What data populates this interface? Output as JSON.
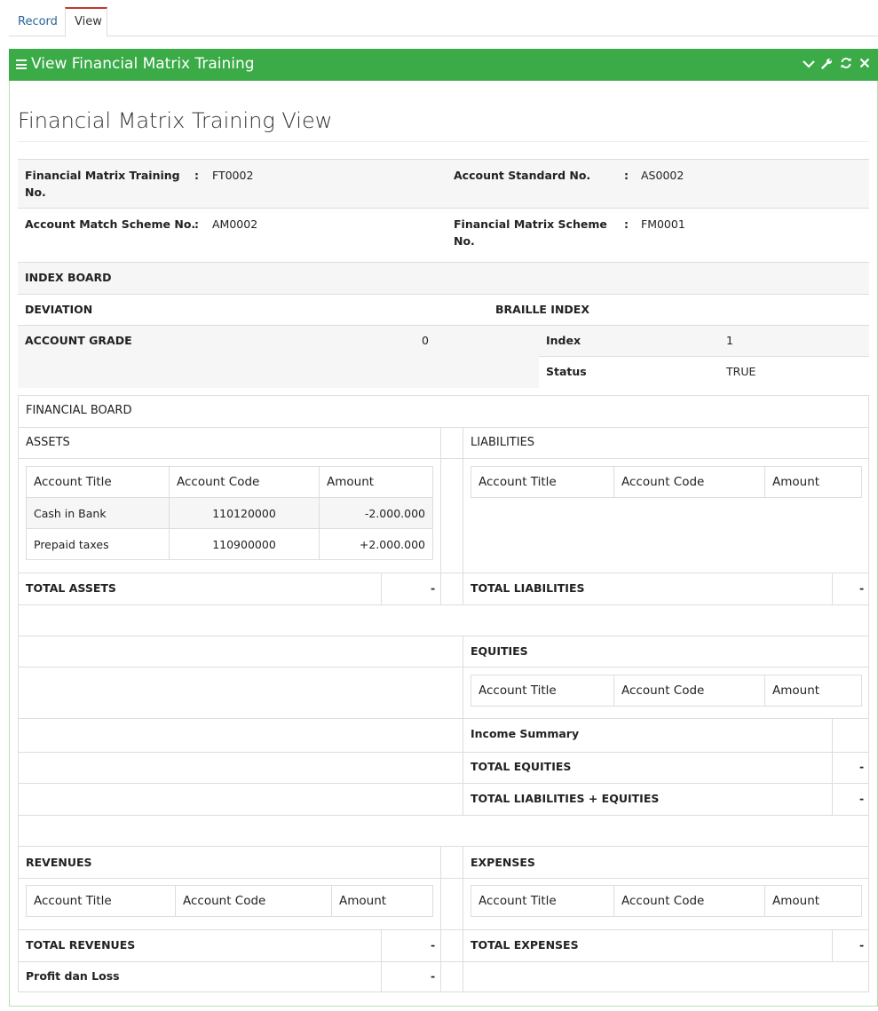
{
  "tabs": [
    {
      "label": "Record"
    },
    {
      "label": "View"
    }
  ],
  "panel": {
    "title": "View Financial Matrix Training"
  },
  "page_title": "Financial Matrix Training View",
  "info": {
    "fmt_no_label": "Financial Matrix Training No.",
    "fmt_no_value": "FT0002",
    "account_standard_label": "Account Standard No.",
    "account_standard_value": "AS0002",
    "account_match_label": "Account Match Scheme No.",
    "account_match_value": "AM0002",
    "financial_matrix_label": "Financial Matrix Scheme No.",
    "financial_matrix_value": "FM0001",
    "colon": ":"
  },
  "index_board": {
    "title": "INDEX BOARD",
    "deviation": "DEVIATION",
    "braille_index": "BRAILLE INDEX",
    "account_grade_label": "ACCOUNT GRADE",
    "account_grade_value": "0",
    "index_label": "Index",
    "index_value": "1",
    "status_label": "Status",
    "status_value": "TRUE"
  },
  "financial_board": {
    "title": "FINANCIAL BOARD",
    "columns": {
      "title": "Account Title",
      "code": "Account Code",
      "amount": "Amount"
    },
    "assets": {
      "title": "ASSETS",
      "rows": [
        {
          "title": "Cash in Bank",
          "code": "110120000",
          "amount": "-2.000.000"
        },
        {
          "title": "Prepaid taxes",
          "code": "110900000",
          "amount": "+2.000.000"
        }
      ],
      "total_label": "TOTAL ASSETS",
      "total_value": "-"
    },
    "liabilities": {
      "title": "LIABILITIES",
      "total_label": "TOTAL LIABILITIES",
      "total_value": "-"
    },
    "equities": {
      "title": "EQUITIES",
      "income_summary": "Income Summary",
      "total_label": "TOTAL EQUITIES",
      "total_value": "-",
      "total_le_label": "TOTAL LIABILITIES + EQUITIES",
      "total_le_value": "-"
    },
    "revenues": {
      "title": "REVENUES",
      "total_label": "TOTAL REVENUES",
      "total_value": "-"
    },
    "expenses": {
      "title": "EXPENSES",
      "total_label": "TOTAL EXPENSES",
      "total_value": "-"
    },
    "profit_loss_label": "Profit dan Loss",
    "profit_loss_value": "-"
  },
  "icons": {
    "menu": "menu-icon",
    "collapse": "chevron-down-icon",
    "settings": "wrench-icon",
    "refresh": "refresh-icon",
    "close": "close-icon"
  },
  "colors": {
    "header_green": "#3aab47",
    "active_tab_border": "#c0392b",
    "link": "#2a6496"
  }
}
